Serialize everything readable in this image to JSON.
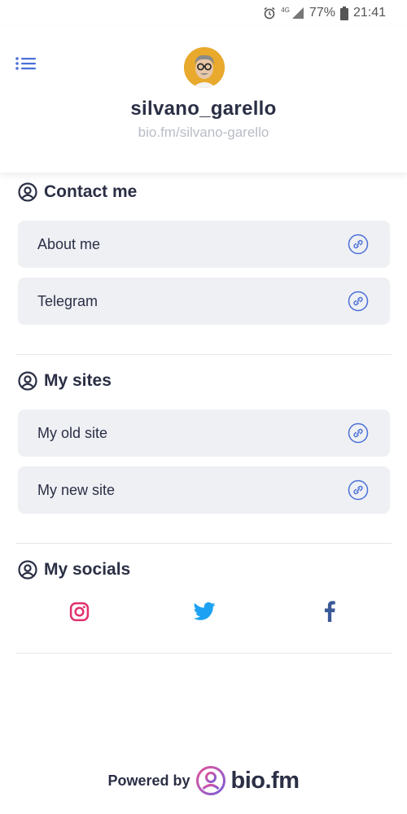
{
  "status_bar": {
    "network": "4G",
    "battery": "77%",
    "time": "21:41"
  },
  "profile": {
    "username": "silvano_garello",
    "url": "bio.fm/silvano-garello"
  },
  "sections": [
    {
      "title": "Contact me",
      "links": [
        {
          "label": "About me"
        },
        {
          "label": "Telegram"
        }
      ]
    },
    {
      "title": "My sites",
      "links": [
        {
          "label": "My old site"
        },
        {
          "label": "My new site"
        }
      ]
    },
    {
      "title": "My socials",
      "socials": [
        {
          "name": "instagram-icon"
        },
        {
          "name": "twitter-icon"
        },
        {
          "name": "facebook-icon"
        }
      ]
    }
  ],
  "footer": {
    "powered_by": "Powered by",
    "brand": "bio.fm"
  },
  "colors": {
    "accent": "#4b6fd8",
    "text": "#2b2f45",
    "muted": "#b9bcc6",
    "card": "#eef0f4",
    "instagram": "#e1306c",
    "twitter": "#1da1f2",
    "facebook": "#3b5998"
  }
}
